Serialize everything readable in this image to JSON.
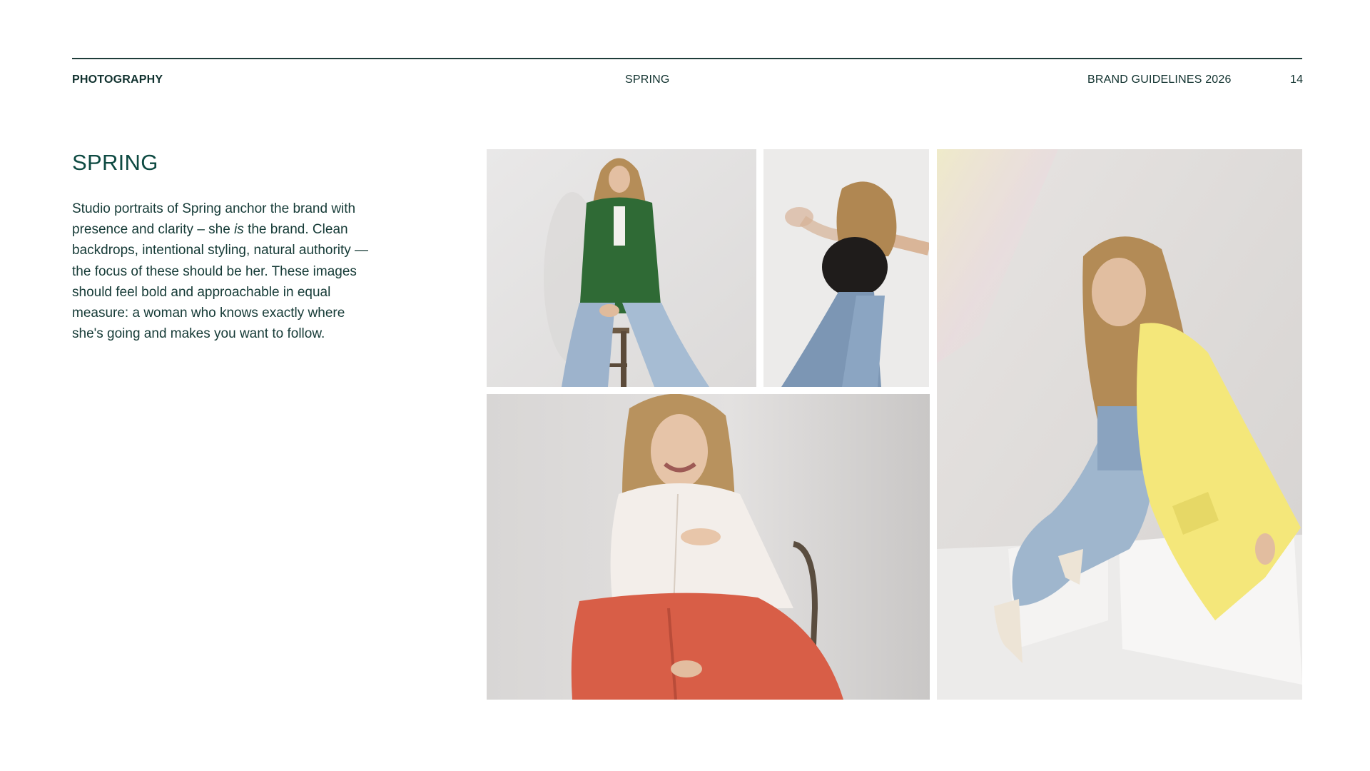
{
  "header": {
    "section": "PHOTOGRAPHY",
    "topic": "SPRING",
    "document": "BRAND GUIDELINES 2026",
    "page_number": "14"
  },
  "content": {
    "title": "SPRING",
    "paragraph_part1": "Studio portraits of Spring anchor the brand with presence and clarity – she ",
    "paragraph_emphasis": "is",
    "paragraph_part2": " the brand. Clean backdrops, intentional styling, natural authority — the focus of these should be her. These images should feel bold and approachable in equal measure: a woman who knows exactly where she's going and makes you want to follow."
  },
  "colors": {
    "text": "#0f3b36",
    "accent": "#0e4a42",
    "rule": "#1f3d3a",
    "backdrop": "#e6e4e4"
  }
}
